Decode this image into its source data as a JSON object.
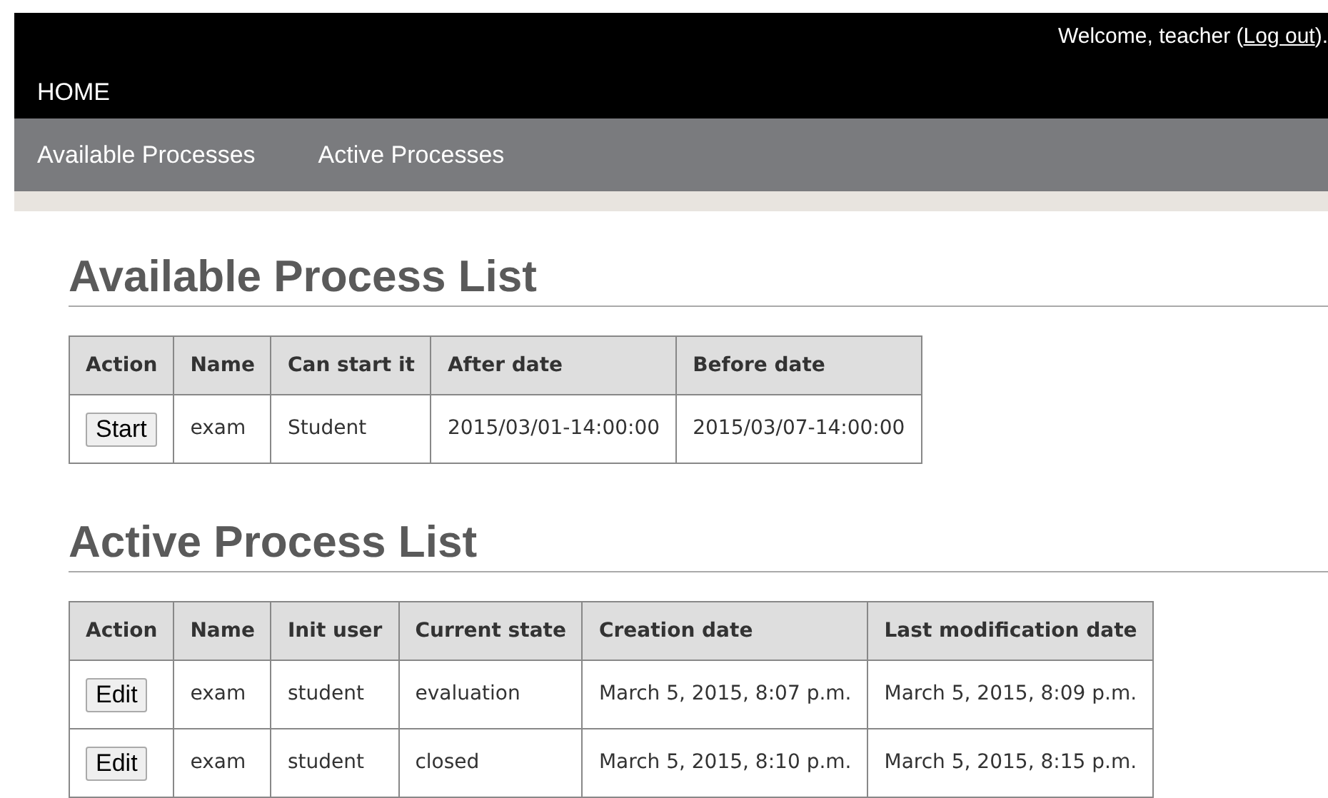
{
  "header": {
    "welcome_before": "Welcome, teacher (",
    "logout_link": "Log out",
    "welcome_after": ").",
    "home": "HOME"
  },
  "nav": {
    "items": [
      {
        "label": "Available Processes"
      },
      {
        "label": "Active Processes"
      }
    ]
  },
  "sections": [
    {
      "title": "Available Process List",
      "table": {
        "columns": [
          "Action",
          "Name",
          "Can start it",
          "After date",
          "Before date"
        ],
        "rows": [
          {
            "cells": [
              {
                "kind": "button",
                "text": "Start"
              },
              {
                "kind": "text",
                "text": "exam"
              },
              {
                "kind": "text",
                "text": "Student"
              },
              {
                "kind": "text",
                "text": "2015/03/01-14:00:00"
              },
              {
                "kind": "text",
                "text": "2015/03/07-14:00:00"
              }
            ]
          }
        ]
      }
    },
    {
      "title": "Active Process List",
      "table": {
        "columns": [
          "Action",
          "Name",
          "Init user",
          "Current state",
          "Creation date",
          "Last modification date"
        ],
        "rows": [
          {
            "cells": [
              {
                "kind": "button",
                "text": "Edit"
              },
              {
                "kind": "text",
                "text": "exam"
              },
              {
                "kind": "text",
                "text": "student"
              },
              {
                "kind": "text",
                "text": "evaluation"
              },
              {
                "kind": "text",
                "text": "March 5, 2015, 8:07 p.m."
              },
              {
                "kind": "text",
                "text": "March 5, 2015, 8:09 p.m."
              }
            ]
          },
          {
            "cells": [
              {
                "kind": "button",
                "text": "Edit"
              },
              {
                "kind": "text",
                "text": "exam"
              },
              {
                "kind": "text",
                "text": "student"
              },
              {
                "kind": "text",
                "text": "closed"
              },
              {
                "kind": "text",
                "text": "March 5, 2015, 8:10 p.m."
              },
              {
                "kind": "text",
                "text": "March 5, 2015, 8:15 p.m."
              }
            ]
          }
        ]
      }
    }
  ]
}
